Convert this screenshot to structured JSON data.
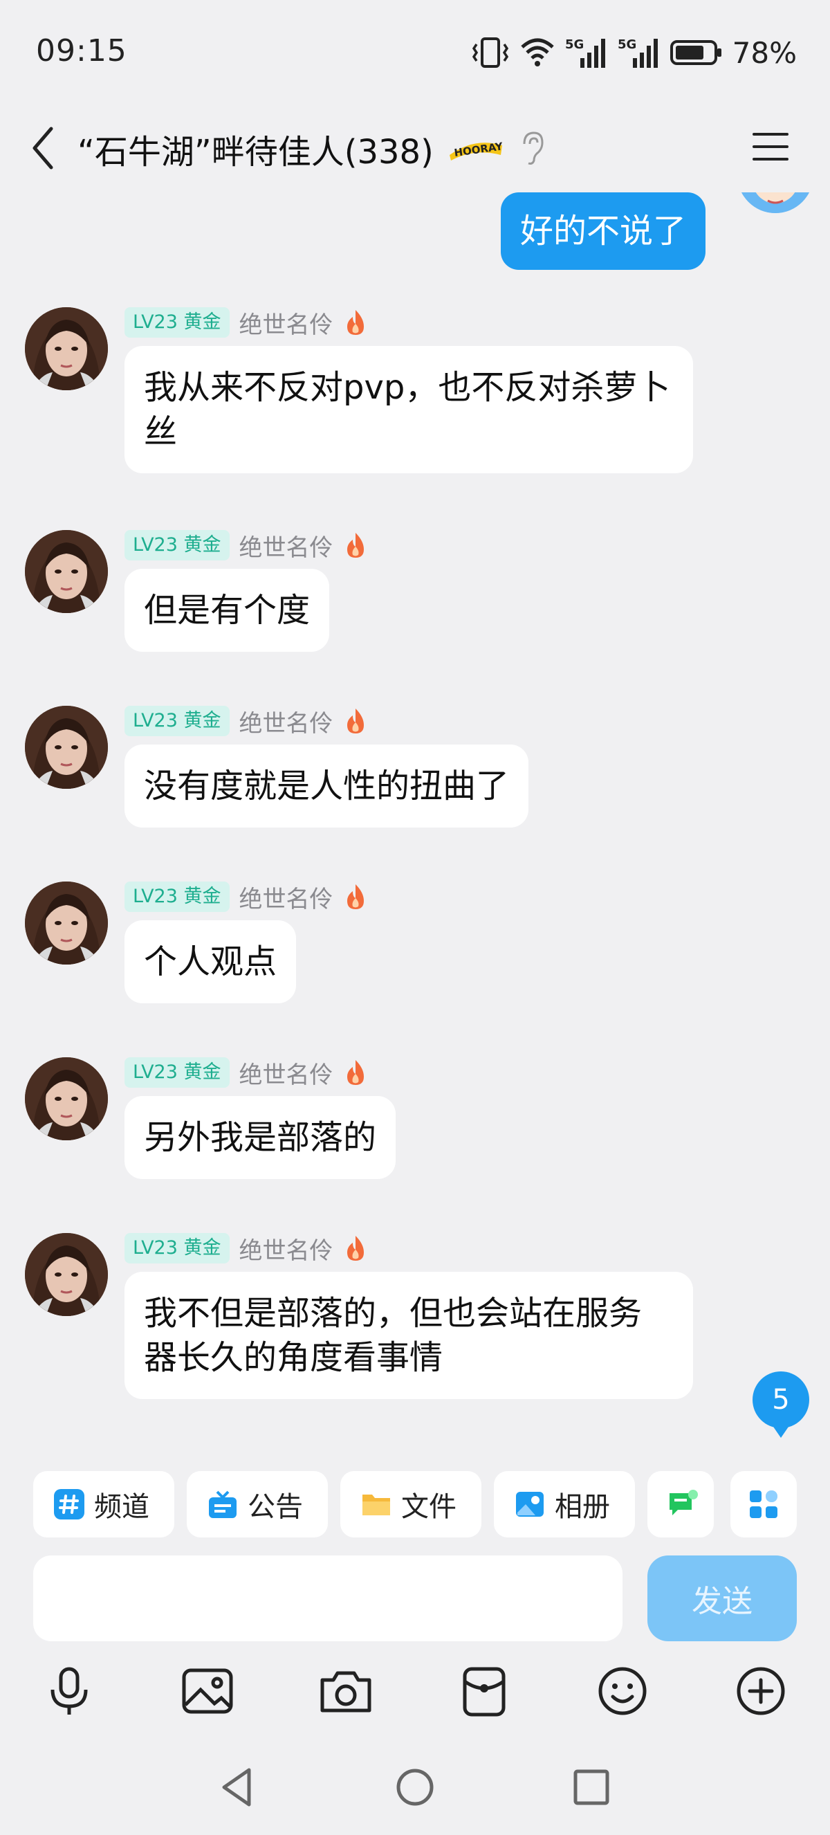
{
  "status": {
    "time": "09:15",
    "net1": "5G",
    "net2": "5G",
    "battery": "78%"
  },
  "header": {
    "title": "“石牛湖”畔待佳人(338)",
    "badge_art": "HOORAY"
  },
  "self_message": {
    "text": "好的不说了"
  },
  "messages": [
    {
      "badge": "LV23 黄金",
      "name": "绝世名伶",
      "text": "我从来不反对pvp，也不反对杀萝卜丝"
    },
    {
      "badge": "LV23 黄金",
      "name": "绝世名伶",
      "text": "但是有个度"
    },
    {
      "badge": "LV23 黄金",
      "name": "绝世名伶",
      "text": "没有度就是人性的扭曲了"
    },
    {
      "badge": "LV23 黄金",
      "name": "绝世名伶",
      "text": "个人观点"
    },
    {
      "badge": "LV23 黄金",
      "name": "绝世名伶",
      "text": "另外我是部落的"
    },
    {
      "badge": "LV23 黄金",
      "name": "绝世名伶",
      "text": "我不但是部落的，但也会站在服务器长久的角度看事情"
    }
  ],
  "unread_count": "5",
  "shortcuts": [
    {
      "label": "频道",
      "icon": "hashtag-icon"
    },
    {
      "label": "公告",
      "icon": "announcement-icon"
    },
    {
      "label": "文件",
      "icon": "folder-icon"
    },
    {
      "label": "相册",
      "icon": "album-icon"
    },
    {
      "label": "",
      "icon": "chat-plugin-icon"
    },
    {
      "label": "",
      "icon": "apps-grid-icon"
    }
  ],
  "input": {
    "value": "",
    "placeholder": ""
  },
  "send_label": "发送",
  "toolbar": [
    "microphone-icon",
    "image-icon",
    "camera-icon",
    "red-packet-icon",
    "emoji-icon",
    "plus-icon"
  ],
  "colors": {
    "accent": "#1d9bf0",
    "send_disabled": "#7cc5f7",
    "badge_bg": "#d6f3ee",
    "badge_text": "#1eae8f",
    "background": "#f0f0f2"
  }
}
